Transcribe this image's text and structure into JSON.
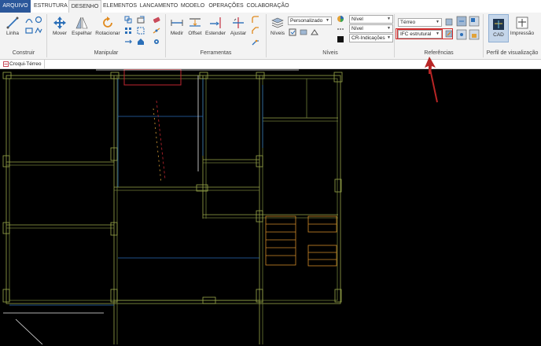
{
  "menu": {
    "items": [
      "ARQUIVO",
      "ESTRUTURA",
      "DESENHO",
      "ELEMENTOS",
      "LANCAMENTO",
      "MODELO",
      "OPERAÇÕES",
      "COLABORAÇÃO"
    ]
  },
  "ribbon": {
    "construir": {
      "linha": "Linha",
      "label": "Construir"
    },
    "manipular": {
      "mover": "Mover",
      "espelhar": "Espelhar",
      "rotacionar": "Rotacionar",
      "label": "Manipular"
    },
    "ferramentas": {
      "medir": "Medir",
      "offset": "Offset",
      "estender": "Estender",
      "ajustar": "Ajustar",
      "label": "Ferramentas"
    },
    "niveis": {
      "niveis": "Níveis",
      "personalizado": "Personalizado",
      "nivel1": "Nível",
      "nivel2": "Nível",
      "cr_indicacoes": "CR-Indicações",
      "label": "Níveis"
    },
    "referencias": {
      "terreo": "Térreo",
      "ifc_estrutural": "IFC estrutural",
      "label": "Referências"
    },
    "perfil": {
      "cad": "CAD",
      "impressao": "Impressão",
      "label": "Perfil de visualização"
    }
  },
  "document_tab": {
    "title": "Croqui-Térreo"
  },
  "colors": {
    "file_tab": "#2b579a",
    "highlight": "#d12b2b",
    "ribbon_bg": "#f3f3f3",
    "cad_bg": "#000000"
  }
}
